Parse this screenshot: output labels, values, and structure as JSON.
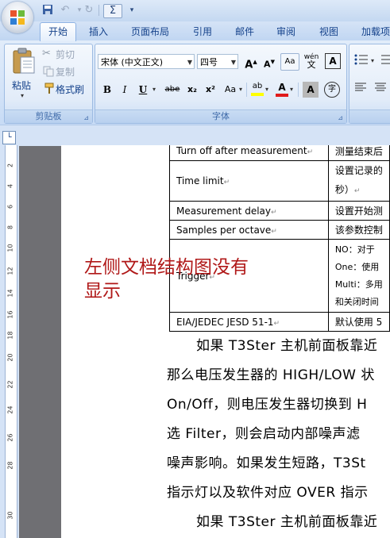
{
  "quick_access": {
    "icons": [
      "save-icon",
      "undo-icon",
      "redo-icon",
      "sigma-icon",
      "customize-icon"
    ]
  },
  "tabs": [
    {
      "label": "开始",
      "active": true
    },
    {
      "label": "插入"
    },
    {
      "label": "页面布局"
    },
    {
      "label": "引用"
    },
    {
      "label": "邮件"
    },
    {
      "label": "审阅"
    },
    {
      "label": "视图"
    },
    {
      "label": "加载项"
    }
  ],
  "clipboard": {
    "paste": "粘贴",
    "cut": "剪切",
    "copy": "复制",
    "format_painter": "格式刷",
    "group_label": "剪贴板"
  },
  "font": {
    "name": "宋体 (中文正文)",
    "size": "四号",
    "group_label": "字体",
    "grow": "A",
    "shrink": "A",
    "phonetic": "wén",
    "bold": "B",
    "italic": "I",
    "underline": "U",
    "strike": "abe",
    "subscript": "x₂",
    "superscript": "x²",
    "change_case": "Aa",
    "highlight": "ab",
    "font_color": "A",
    "char_shading": "A",
    "enclose": "字"
  },
  "ruler": {
    "numbers": [
      "2",
      "4",
      "6",
      "8",
      "10",
      "12",
      "14",
      "16",
      "18",
      "20",
      "22",
      "24",
      "26",
      "28",
      "30"
    ]
  },
  "table_rows": [
    {
      "left": "Turn off after measurement",
      "right": "测量结束后"
    },
    {
      "left": "Time limit",
      "right": "设置记录的",
      "right2": "秒）"
    },
    {
      "left": "Measurement delay",
      "right": "设置开始测"
    },
    {
      "left": "Samples per octave",
      "right": "该参数控制"
    },
    {
      "left": "Trigger",
      "right": "NO：对于",
      "right2": "One：使用",
      "right3": "Multi：多用",
      "right4": "和关闭时间"
    },
    {
      "left": "EIA/JEDEC JESD 51-1",
      "right": "默认使用 5"
    }
  ],
  "paragraphs": [
    "　　如果 T3Ster 主机前面板靠近",
    "那么电压发生器的 HIGH/LOW 状",
    "On/Off，则电压发生器切换到 H",
    "选 Filter，则会启动内部噪声滤",
    "噪声影响。如果发生短路，T3St",
    "指示灯以及软件对应 OVER 指示",
    "　　如果 T3Ster 主机前面板靠近"
  ],
  "annotation": {
    "line1": "左侧文档结构图没有",
    "line2": "显示"
  }
}
